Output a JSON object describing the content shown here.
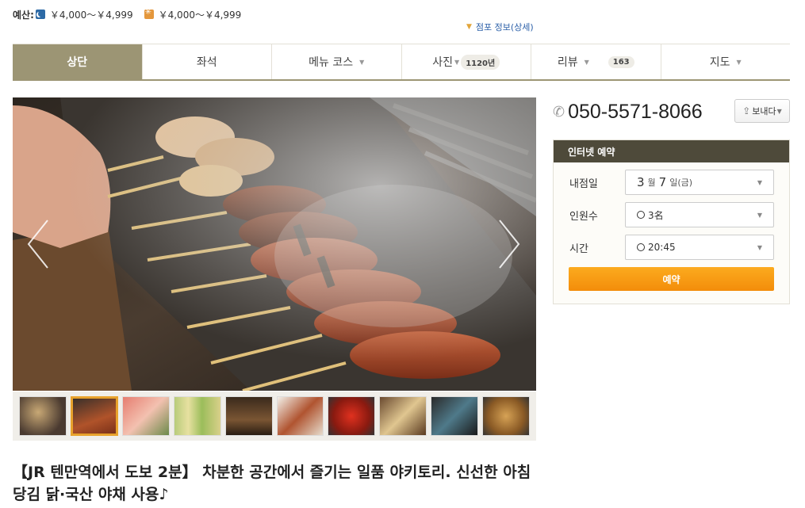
{
  "budget": {
    "label": "예산:",
    "dinner": "￥4,000～￥4,999",
    "lunch": "￥4,000～￥4,999"
  },
  "store_info_link": "점포 정보(상세)",
  "tabs": [
    {
      "label": "상단",
      "active": true
    },
    {
      "label": "좌석"
    },
    {
      "label": "메뉴 코스"
    },
    {
      "label": "사진",
      "count": "1120년"
    },
    {
      "label": "리뷰",
      "count": "163"
    },
    {
      "label": "지도"
    }
  ],
  "headline": "【JR 텐만역에서 도보 2분】 차분한 공간에서 즐기는 일품 야키토리. 신선한 아침 당김 닭·국산 야채 사용♪",
  "phone": "050-5571-8066",
  "send_button": "보내다",
  "reservation": {
    "title": "인터넷 예약",
    "date_label": "내점일",
    "date_month": "3",
    "month_unit": "월",
    "date_day": "7",
    "day_unit": "일(금)",
    "people_label": "인원수",
    "people_value": "3名",
    "time_label": "시간",
    "time_value": "20:45",
    "submit": "예약"
  },
  "colors": {
    "tab_active": "#9c9574",
    "reserve_header": "#4e4a3a",
    "reserve_button": "#f59a12",
    "link": "#2b5fa8"
  }
}
